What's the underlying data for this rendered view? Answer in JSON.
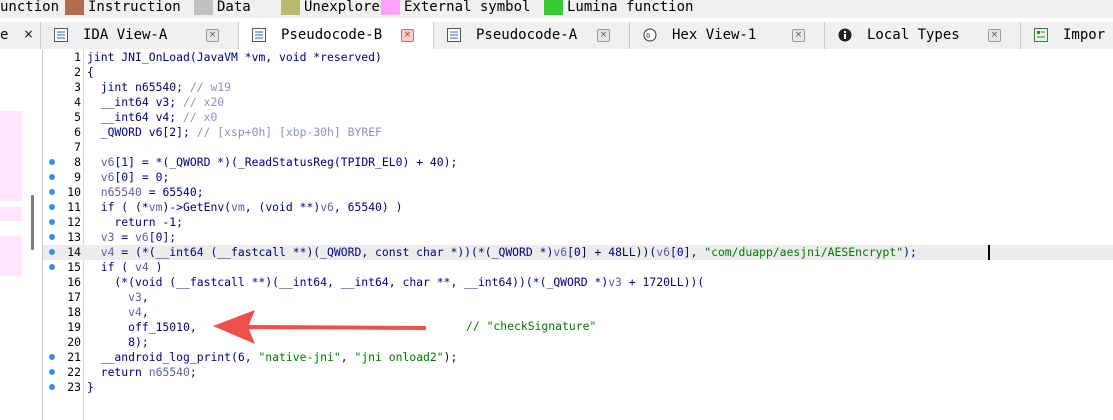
{
  "legend": {
    "items": [
      {
        "label": "unction",
        "color": ""
      },
      {
        "label": "Instruction",
        "color": "#b46a4f"
      },
      {
        "label": "Data",
        "color": "#c0c0c0"
      },
      {
        "label": "Unexplored",
        "color": "#b8b86e"
      },
      {
        "label": "External symbol",
        "color": "#ffa3ff"
      },
      {
        "label": "Lumina function",
        "color": "#33cc33"
      }
    ]
  },
  "tabs": [
    {
      "label": "",
      "icon": "list-icon",
      "active": false
    },
    {
      "label": "IDA View-A",
      "icon": "list-icon",
      "active": false
    },
    {
      "label": "Pseudocode-B",
      "icon": "list-icon",
      "active": true
    },
    {
      "label": "Pseudocode-A",
      "icon": "list-icon",
      "active": false
    },
    {
      "label": "Hex View-1",
      "icon": "hex-icon",
      "active": false
    },
    {
      "label": "Local Types",
      "icon": "info-icon",
      "active": false
    },
    {
      "label": "Impor",
      "icon": "imports-icon",
      "active": false
    }
  ],
  "left_pane": {
    "label": "e"
  },
  "code": {
    "lines": [
      {
        "n": "1",
        "dot": false,
        "hl": false,
        "segs": [
          [
            "kw",
            "jint JNI_OnLoad(JavaVM *vm, void *reserved)"
          ]
        ]
      },
      {
        "n": "2",
        "dot": false,
        "hl": false,
        "segs": [
          [
            "kw",
            "{"
          ]
        ]
      },
      {
        "n": "3",
        "dot": false,
        "hl": false,
        "segs": [
          [
            "kw",
            "  jint n65540; "
          ],
          [
            "cm",
            "// w19"
          ]
        ]
      },
      {
        "n": "4",
        "dot": false,
        "hl": false,
        "segs": [
          [
            "kw",
            "  __int64 v3; "
          ],
          [
            "cm",
            "// x20"
          ]
        ]
      },
      {
        "n": "5",
        "dot": false,
        "hl": false,
        "segs": [
          [
            "kw",
            "  __int64 v4; "
          ],
          [
            "cm",
            "// x0"
          ]
        ]
      },
      {
        "n": "6",
        "dot": false,
        "hl": false,
        "segs": [
          [
            "kw",
            "  _QWORD v6[2]; "
          ],
          [
            "cm",
            "// [xsp+0h] [xbp-30h] BYREF"
          ]
        ]
      },
      {
        "n": "7",
        "dot": false,
        "hl": false,
        "segs": [
          [
            "kw",
            ""
          ]
        ]
      },
      {
        "n": "8",
        "dot": true,
        "hl": false,
        "segs": [
          [
            "kw",
            "  "
          ],
          [
            "lv",
            "v6"
          ],
          [
            "kw",
            "[1] = *(_QWORD *)(_ReadStatusReg(TPIDR_EL0) + 40);"
          ]
        ]
      },
      {
        "n": "9",
        "dot": true,
        "hl": false,
        "segs": [
          [
            "kw",
            "  "
          ],
          [
            "lv",
            "v6"
          ],
          [
            "kw",
            "[0] = 0;"
          ]
        ]
      },
      {
        "n": "10",
        "dot": true,
        "hl": false,
        "segs": [
          [
            "kw",
            "  "
          ],
          [
            "lv",
            "n65540"
          ],
          [
            "kw",
            " = 65540;"
          ]
        ]
      },
      {
        "n": "11",
        "dot": true,
        "hl": false,
        "segs": [
          [
            "kw",
            "  if ( (*"
          ],
          [
            "lv",
            "vm"
          ],
          [
            "kw",
            ")->GetEnv("
          ],
          [
            "lv",
            "vm"
          ],
          [
            "kw",
            ", (void **)"
          ],
          [
            "lv",
            "v6"
          ],
          [
            "kw",
            ", 65540) )"
          ]
        ]
      },
      {
        "n": "12",
        "dot": true,
        "hl": false,
        "segs": [
          [
            "kw",
            "    return -1;"
          ]
        ]
      },
      {
        "n": "13",
        "dot": true,
        "hl": false,
        "segs": [
          [
            "kw",
            "  "
          ],
          [
            "lv",
            "v3"
          ],
          [
            "kw",
            " = "
          ],
          [
            "lv",
            "v6"
          ],
          [
            "kw",
            "[0];"
          ]
        ]
      },
      {
        "n": "14",
        "dot": true,
        "hl": true,
        "segs": [
          [
            "kw",
            "  "
          ],
          [
            "lv",
            "v4"
          ],
          [
            "kw",
            " = (*(__int64 (__fastcall **)(_QWORD, const char *))(*(_QWORD *)"
          ],
          [
            "lv",
            "v6"
          ],
          [
            "kw",
            "[0] + 48LL))("
          ],
          [
            "lv",
            "v6"
          ],
          [
            "kw",
            "[0], "
          ],
          [
            "str",
            "\"com/duapp/aesjni/AESEncrypt\""
          ],
          [
            "kw",
            ");"
          ]
        ]
      },
      {
        "n": "15",
        "dot": true,
        "hl": false,
        "segs": [
          [
            "kw",
            "  if ( "
          ],
          [
            "lv",
            "v4"
          ],
          [
            "kw",
            " )"
          ]
        ]
      },
      {
        "n": "16",
        "dot": false,
        "hl": false,
        "segs": [
          [
            "kw",
            "    (*(void (__fastcall **)(__int64, __int64, char **, __int64))(*(_QWORD *)"
          ],
          [
            "lv",
            "v3"
          ],
          [
            "kw",
            " + 1720LL))("
          ]
        ]
      },
      {
        "n": "17",
        "dot": false,
        "hl": false,
        "segs": [
          [
            "kw",
            "      "
          ],
          [
            "lv",
            "v3"
          ],
          [
            "kw",
            ","
          ]
        ]
      },
      {
        "n": "18",
        "dot": false,
        "hl": false,
        "segs": [
          [
            "kw",
            "      "
          ],
          [
            "lv",
            "v4"
          ],
          [
            "kw",
            ","
          ]
        ]
      },
      {
        "n": "19",
        "dot": false,
        "hl": false,
        "segs": [
          [
            "kw",
            "      off_15010,"
          ]
        ]
      },
      {
        "n": "20",
        "dot": false,
        "hl": false,
        "segs": [
          [
            "kw",
            "      8);"
          ]
        ]
      },
      {
        "n": "21",
        "dot": true,
        "hl": false,
        "segs": [
          [
            "kw",
            "  __android_log_print(6, "
          ],
          [
            "str",
            "\"native-jni\""
          ],
          [
            "kw",
            ", "
          ],
          [
            "str",
            "\"jni onload2\""
          ],
          [
            "kw",
            ");"
          ]
        ]
      },
      {
        "n": "22",
        "dot": true,
        "hl": false,
        "segs": [
          [
            "kw",
            "  return "
          ],
          [
            "lv",
            "n65540"
          ],
          [
            "kw",
            ";"
          ]
        ]
      },
      {
        "n": "23",
        "dot": true,
        "hl": false,
        "segs": [
          [
            "kw",
            "}"
          ]
        ]
      }
    ],
    "annotation": "// \"checkSignature\"",
    "colors": {
      "arrow": "#f0504a",
      "comment": "#007a00"
    }
  }
}
